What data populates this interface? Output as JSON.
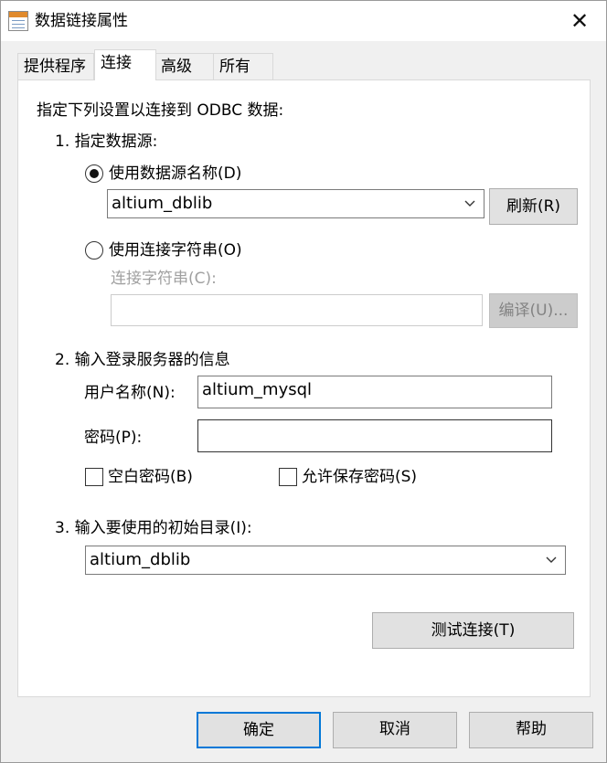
{
  "window": {
    "title": "数据链接属性",
    "close_glyph": "✕"
  },
  "tabs": [
    {
      "label": "提供程序",
      "active": false
    },
    {
      "label": "连接",
      "active": true
    },
    {
      "label": "高级",
      "active": false
    },
    {
      "label": "所有",
      "active": false
    }
  ],
  "panel": {
    "intro": "指定下列设置以连接到 ODBC 数据:",
    "section1": {
      "heading": "1. 指定数据源:",
      "radio_dsn_label": "使用数据源名称(D)",
      "radio_dsn_checked": true,
      "dsn_value": "altium_dblib",
      "refresh_button": "刷新(R)",
      "radio_connstr_label": "使用连接字符串(O)",
      "radio_connstr_checked": false,
      "connstr_label": "连接字符串(C):",
      "connstr_value": "",
      "compile_button": "编译(U)..."
    },
    "section2": {
      "heading": "2. 输入登录服务器的信息",
      "username_label": "用户名称(N):",
      "username_value": "altium_mysql",
      "password_label": "密码(P):",
      "password_value": "",
      "blank_password_label": "空白密码(B)",
      "blank_password_checked": false,
      "save_password_label": "允许保存密码(S)",
      "save_password_checked": false
    },
    "section3": {
      "heading": "3. 输入要使用的初始目录(I):",
      "catalog_value": "altium_dblib"
    },
    "test_button": "测试连接(T)"
  },
  "footer": {
    "ok": "确定",
    "cancel": "取消",
    "help": "帮助"
  }
}
